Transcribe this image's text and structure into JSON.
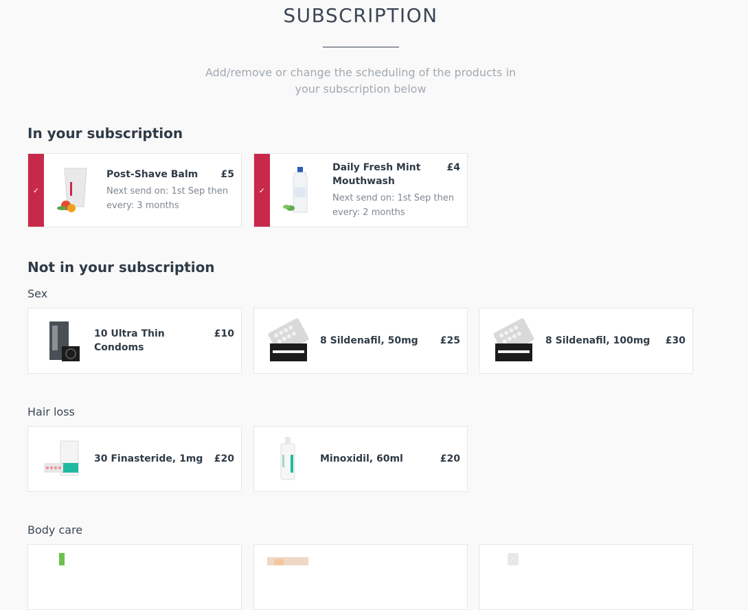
{
  "page": {
    "title": "SUBSCRIPTION",
    "subtitle": "Add/remove or change the scheduling of the products in your subscription below"
  },
  "in_subscription": {
    "heading": "In your subscription",
    "items": [
      {
        "name": "Post-Shave Balm",
        "price": "£5",
        "schedule": "Next send on: 1st Sep then every: 3 months",
        "icon": "check-icon",
        "image": "post-shave-balm-image"
      },
      {
        "name": "Daily Fresh Mint Mouthwash",
        "price": "£4",
        "schedule": "Next send on: 1st Sep then every: 2 months",
        "icon": "check-icon",
        "image": "mouthwash-image"
      }
    ]
  },
  "not_in_subscription": {
    "heading": "Not in your subscription",
    "categories": [
      {
        "name": "Sex",
        "items": [
          {
            "name": "10 Ultra Thin Condoms",
            "price": "£10",
            "image": "condoms-image"
          },
          {
            "name": "8 Sildenafil, 50mg",
            "price": "£25",
            "image": "sildenafil-50-image"
          },
          {
            "name": "8 Sildenafil, 100mg",
            "price": "£30",
            "image": "sildenafil-100-image"
          }
        ]
      },
      {
        "name": "Hair loss",
        "items": [
          {
            "name": "30 Finasteride, 1mg",
            "price": "£20",
            "image": "finasteride-image"
          },
          {
            "name": "Minoxidil, 60ml",
            "price": "£20",
            "image": "minoxidil-image"
          }
        ]
      },
      {
        "name": "Body care",
        "items": [
          {
            "image": "body-care-product-1-image"
          },
          {
            "image": "body-care-product-2-image"
          },
          {
            "image": "body-care-product-3-image"
          }
        ]
      }
    ]
  },
  "colors": {
    "accent": "#c8294a",
    "heading": "#2f3b47",
    "muted": "#a1a9b1",
    "card_border": "#e6e6e6"
  }
}
